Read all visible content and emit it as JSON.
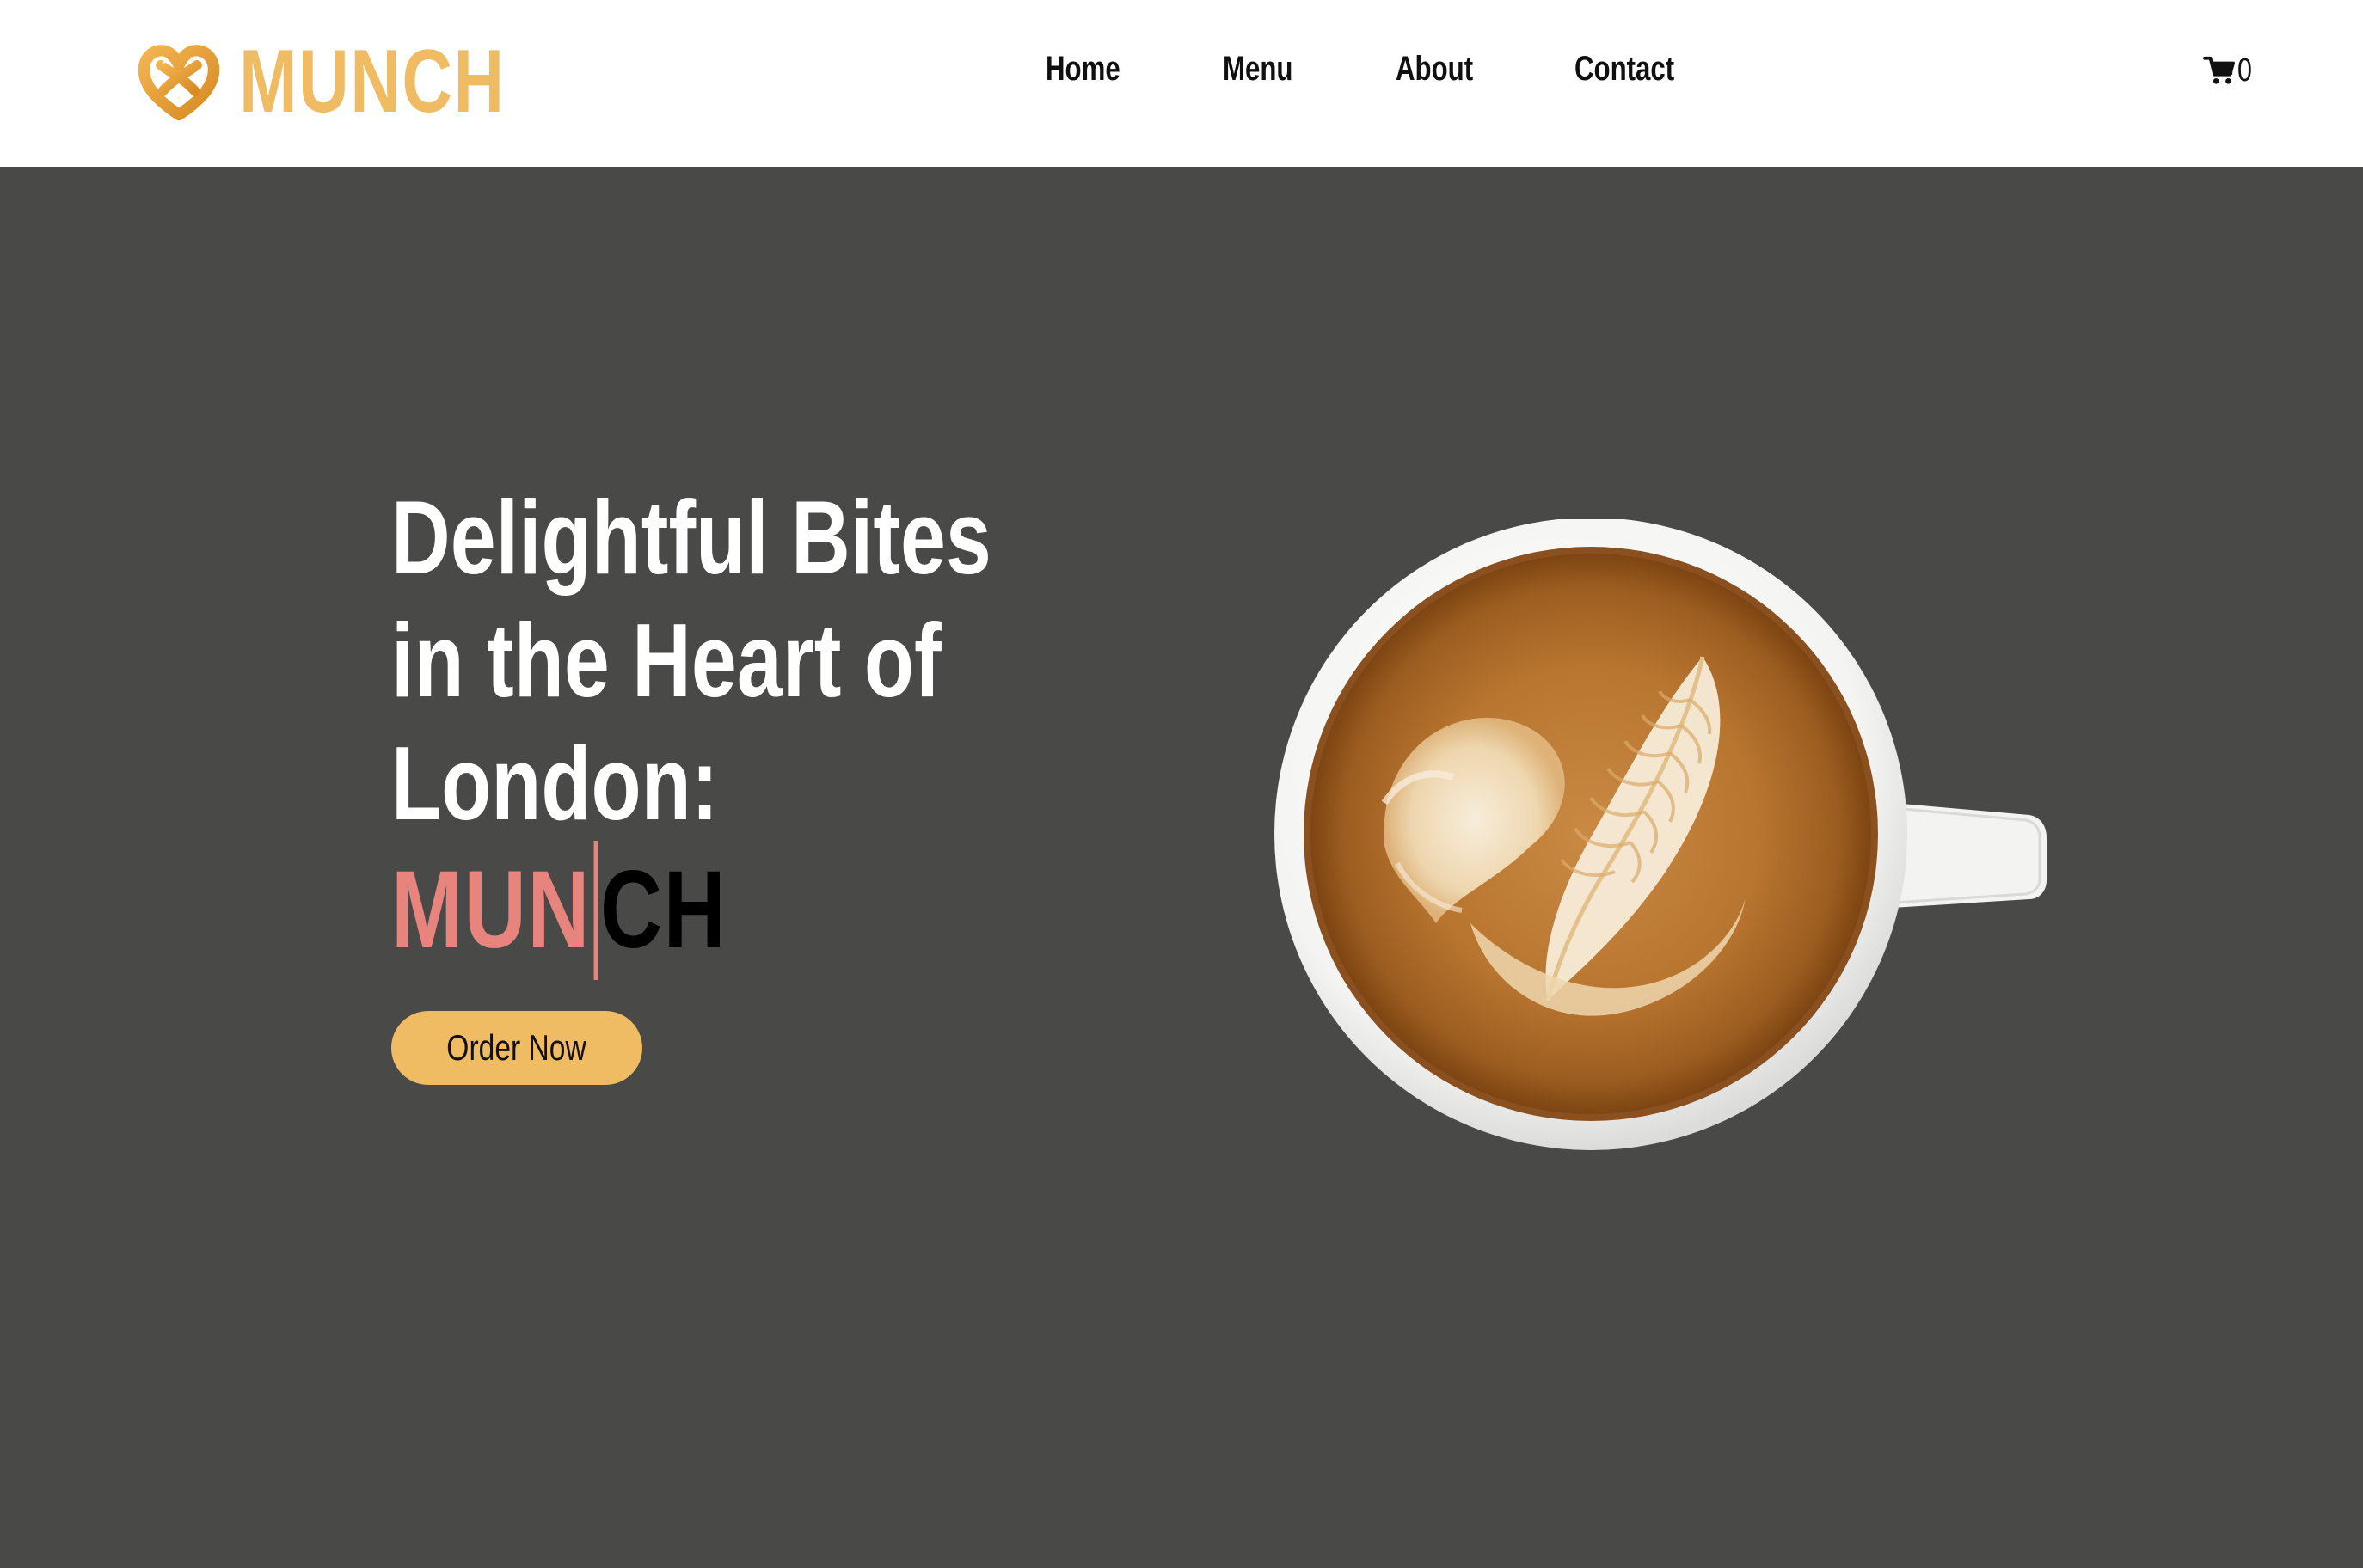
{
  "brand": {
    "name": "MUNCH",
    "logo_icon": "pretzel-heart-icon",
    "color": "#f0bc63"
  },
  "nav": {
    "items": [
      {
        "label": "Home"
      },
      {
        "label": "Menu"
      },
      {
        "label": "About"
      },
      {
        "label": "Contact"
      }
    ]
  },
  "cart": {
    "icon": "cart-icon",
    "count": "0"
  },
  "hero": {
    "headline_lines": [
      "Delightful Bites",
      "in the Heart of",
      "London:"
    ],
    "typed_word_visible": "MUN",
    "typed_word_rest": "CH",
    "typed_color": "#e7847e",
    "button_label": "Order Now",
    "button_color": "#f0bc63",
    "background_color": "#494a48",
    "image": "latte-art-coffee-cup"
  }
}
